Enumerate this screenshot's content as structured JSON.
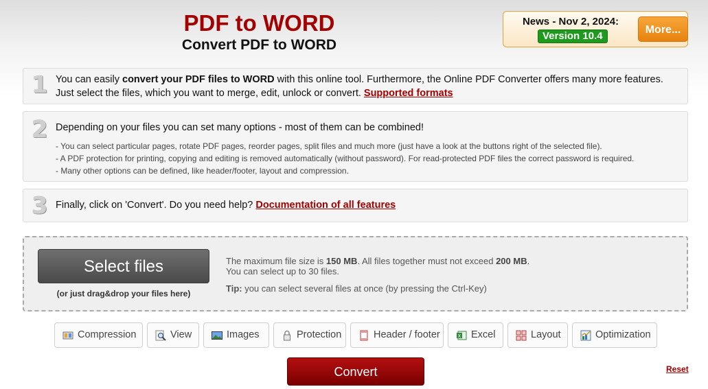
{
  "header": {
    "title": "PDF to WORD",
    "subtitle": "Convert PDF to WORD"
  },
  "news": {
    "title": "News - Nov 2, 2024:",
    "version": "Version 10.4",
    "more_label": "More..."
  },
  "steps": [
    {
      "number": "1",
      "text_before": "You can easily ",
      "text_bold": "convert your PDF files to WORD",
      "text_after": " with this online tool. Furthermore, the Online PDF Converter offers many more features. Just select the files, which you want to merge, edit, unlock or convert. ",
      "link": "Supported formats"
    },
    {
      "number": "2",
      "text": "Depending on your files you can set many options - most of them can be combined!",
      "bullets": [
        "- You can select particular pages, rotate PDF pages, reorder pages, split files and much more (just have a look at the buttons right of the selected file).",
        "- A PDF protection for printing, copying and editing is removed automatically (without password). For read-protected PDF files the correct password is required.",
        "- Many other options can be defined, like header/footer, layout and compression."
      ]
    },
    {
      "number": "3",
      "text": "Finally, click on 'Convert'. Do you need help? ",
      "link": "Documentation of all features"
    }
  ],
  "upload": {
    "select_label": "Select files",
    "drag_hint": "(or just drag&drop your files here)",
    "limits_1": "The maximum file size is ",
    "max_file_size": "150 MB",
    "limits_2": ". All files together must not exceed ",
    "max_total_size": "200 MB",
    "limits_3": ".",
    "limits_line2": "You can select up to 30 files.",
    "tip_label": "Tip:",
    "tip_text": " you can select several files at once (by pressing the Ctrl-Key)"
  },
  "options": [
    {
      "label": "Compression",
      "icon": "compression-icon"
    },
    {
      "label": "View",
      "icon": "magnifier-icon"
    },
    {
      "label": "Images",
      "icon": "image-icon"
    },
    {
      "label": "Protection",
      "icon": "lock-icon"
    },
    {
      "label": "Header / footer",
      "icon": "page-icon"
    },
    {
      "label": "Excel",
      "icon": "excel-icon"
    },
    {
      "label": "Layout",
      "icon": "grid-icon"
    },
    {
      "label": "Optimization",
      "icon": "chart-icon"
    }
  ],
  "convert_label": "Convert",
  "reset_label": "Reset",
  "colors": {
    "brand_red": "#a30000",
    "version_green": "#1e9b1e",
    "more_orange": "#f09020"
  }
}
